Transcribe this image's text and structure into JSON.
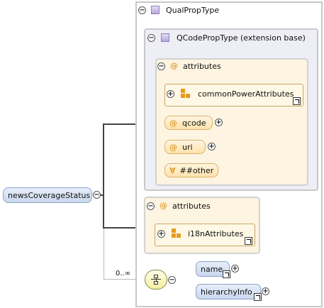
{
  "root": {
    "label": "newsCoverageStatus",
    "toggle": "−"
  },
  "qualproptype": {
    "label": "QualPropType",
    "toggle": "−"
  },
  "qcodeproptype": {
    "label": "QCodePropType (extension base)",
    "toggle": "−"
  },
  "inner_attributes": {
    "label": "attributes",
    "at": "@",
    "toggle": "−",
    "group": {
      "label": "commonPowerAttributes",
      "toggle": "+"
    },
    "items": [
      {
        "at": "@",
        "label": "qcode",
        "toggle": "+"
      },
      {
        "at": "@",
        "label": "uri",
        "toggle": "+"
      }
    ],
    "any": {
      "symbol": "∀",
      "label": "##other"
    }
  },
  "outer_attributes": {
    "label": "attributes",
    "at": "@",
    "toggle": "−",
    "group": {
      "label": "i18nAttributes",
      "toggle": "+"
    }
  },
  "sequence": {
    "cardinality": "0..∞",
    "toggle": "−",
    "children": [
      {
        "label": "name",
        "toggle": "+"
      },
      {
        "label": "hierarchyInfo",
        "toggle": "+"
      }
    ]
  }
}
